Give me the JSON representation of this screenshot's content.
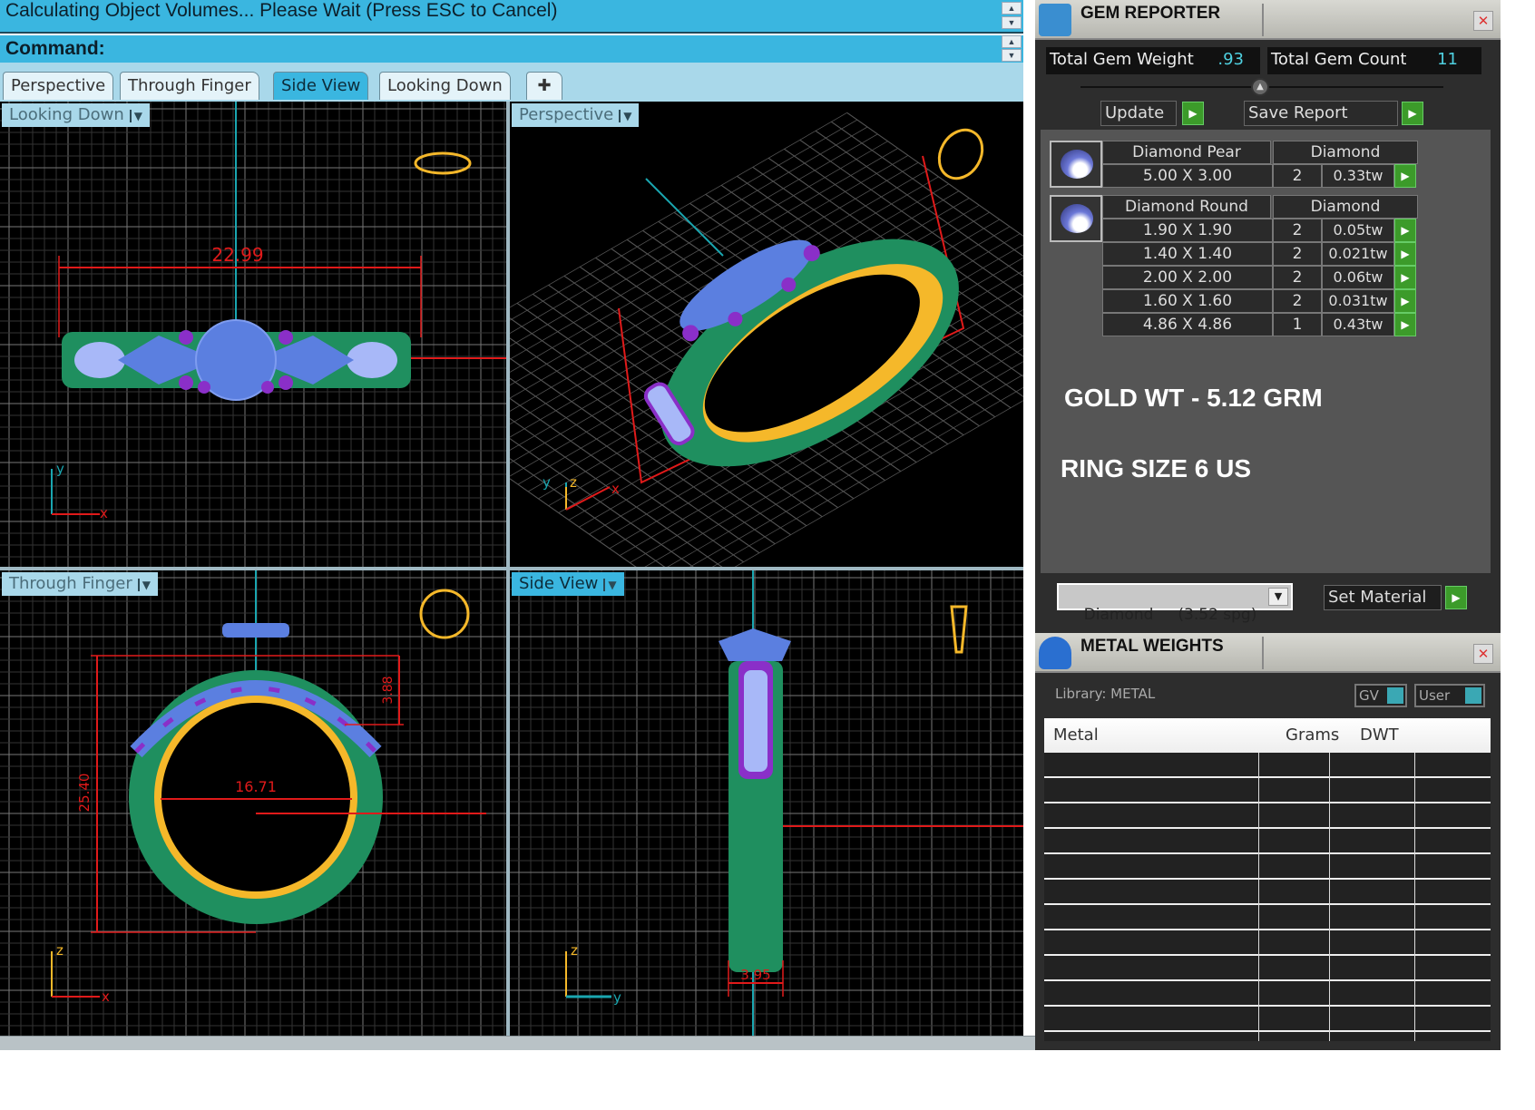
{
  "status": {
    "message": "Calculating Object Volumes... Please Wait (Press ESC to Cancel)",
    "command_label": "Command:"
  },
  "tabs": [
    {
      "label": "Perspective",
      "active": false
    },
    {
      "label": "Through Finger",
      "active": false
    },
    {
      "label": "Side View",
      "active": true
    },
    {
      "label": "Looking Down",
      "active": false
    }
  ],
  "add_tab_icon": "plus-icon",
  "viewports": {
    "looking_down": {
      "label": "Looking Down",
      "dimension": "22.99",
      "axis_x": "x",
      "axis_y": "y"
    },
    "perspective": {
      "label": "Perspective",
      "axis_x": "x",
      "axis_y": "y",
      "axis_z": "z"
    },
    "through_finger": {
      "label": "Through Finger",
      "dim_height": "25.40",
      "dim_inner": "16.71",
      "dim_top": "3.88",
      "axis_x": "x",
      "axis_z": "z"
    },
    "side_view": {
      "label": "Side View",
      "dimension": "3.95",
      "axis_y": "y",
      "axis_z": "z"
    }
  },
  "gem_reporter": {
    "title": "GEM REPORTER",
    "total_weight_label": "Total Gem Weight",
    "total_weight": ".93",
    "total_count_label": "Total Gem Count",
    "total_count": "11",
    "update_label": "Update",
    "save_report_label": "Save Report",
    "groups": [
      {
        "shape": "Diamond Pear",
        "material": "Diamond",
        "rows": [
          {
            "size": "5.00 X 3.00",
            "count": "2",
            "weight": "0.33tw"
          }
        ]
      },
      {
        "shape": "Diamond Round",
        "material": "Diamond",
        "rows": [
          {
            "size": "1.90 X 1.90",
            "count": "2",
            "weight": "0.05tw"
          },
          {
            "size": "1.40 X 1.40",
            "count": "2",
            "weight": "0.021tw"
          },
          {
            "size": "2.00 X 2.00",
            "count": "2",
            "weight": "0.06tw"
          },
          {
            "size": "1.60 X 1.60",
            "count": "2",
            "weight": "0.031tw"
          },
          {
            "size": "4.86 X 4.86",
            "count": "1",
            "weight": "0.43tw"
          }
        ]
      }
    ],
    "gold_weight_note": "GOLD WT - 5.12 GRM",
    "ring_size_note": "RING SIZE 6 US",
    "material_select": "Diamond     (3.52 spg)",
    "set_material_label": "Set Material"
  },
  "metal_weights": {
    "title": "METAL WEIGHTS",
    "library_label": "Library: METAL",
    "gv_label": "GV",
    "user_label": "User",
    "columns": [
      "Metal",
      "Grams",
      "DWT"
    ],
    "rows": []
  },
  "colors": {
    "accent": "#3ab6e0",
    "metal_green": "#1f8f5f",
    "gold": "#f5b82a",
    "gem_blue": "#5b7fe0",
    "gem_purple": "#8a2fc8",
    "dimension_red": "#e01a1a"
  }
}
